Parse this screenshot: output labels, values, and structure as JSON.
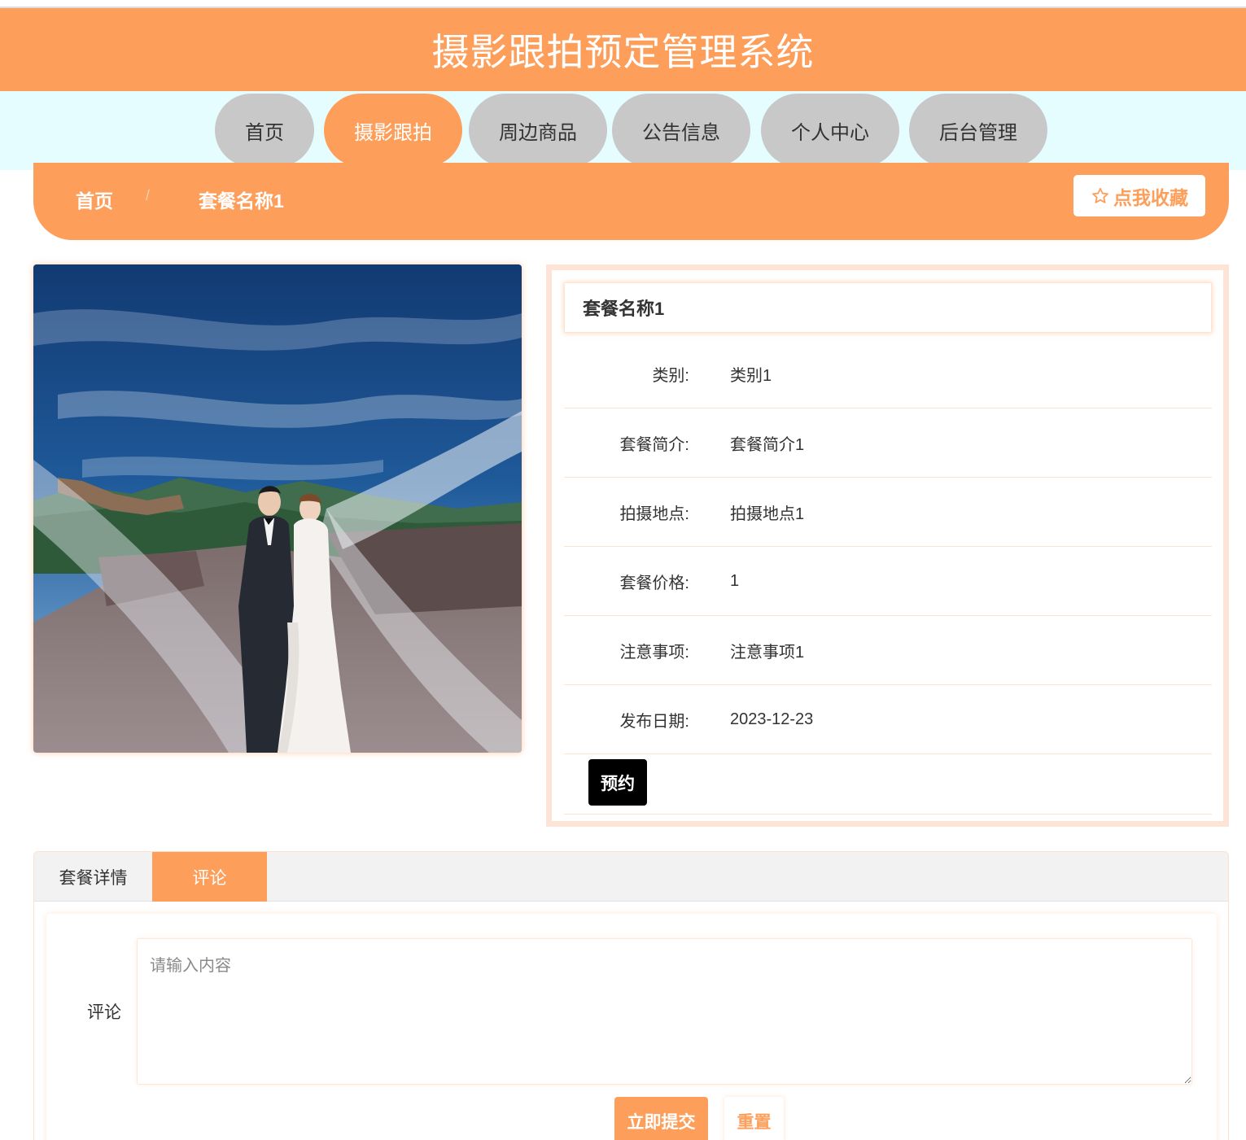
{
  "app": {
    "title": "摄影跟拍预定管理系统"
  },
  "nav": {
    "items": [
      {
        "label": "首页",
        "active": false
      },
      {
        "label": "摄影跟拍",
        "active": true
      },
      {
        "label": "周边商品",
        "active": false
      },
      {
        "label": "公告信息",
        "active": false
      },
      {
        "label": "个人中心",
        "active": false
      },
      {
        "label": "后台管理",
        "active": false
      }
    ]
  },
  "breadcrumb": {
    "home": "首页",
    "separator": "/",
    "current": "套餐名称1"
  },
  "favorite": {
    "label": "点我收藏",
    "icon": "star-outline-icon"
  },
  "photo": {
    "alt": "wedding-couple-great-wall-photo"
  },
  "detail": {
    "title": "套餐名称1",
    "fields": [
      {
        "label": "类别:",
        "value": "类别1"
      },
      {
        "label": "套餐简介:",
        "value": "套餐简介1"
      },
      {
        "label": "拍摄地点:",
        "value": "拍摄地点1"
      },
      {
        "label": "套餐价格:",
        "value": "1"
      },
      {
        "label": "注意事项:",
        "value": "注意事项1"
      },
      {
        "label": "发布日期:",
        "value": "2023-12-23"
      }
    ],
    "book_label": "预约"
  },
  "tabs": [
    {
      "label": "套餐详情",
      "active": false
    },
    {
      "label": "评论",
      "active": true
    }
  ],
  "comment": {
    "label": "评论",
    "placeholder": "请输入内容",
    "submit_label": "立即提交",
    "reset_label": "重置"
  },
  "colors": {
    "accent": "#fd9f5b",
    "nav_bg": "#e6fdff",
    "nav_item_bg": "#c8c8c8",
    "panel_border": "#fde4d6",
    "book_button": "#000000"
  }
}
